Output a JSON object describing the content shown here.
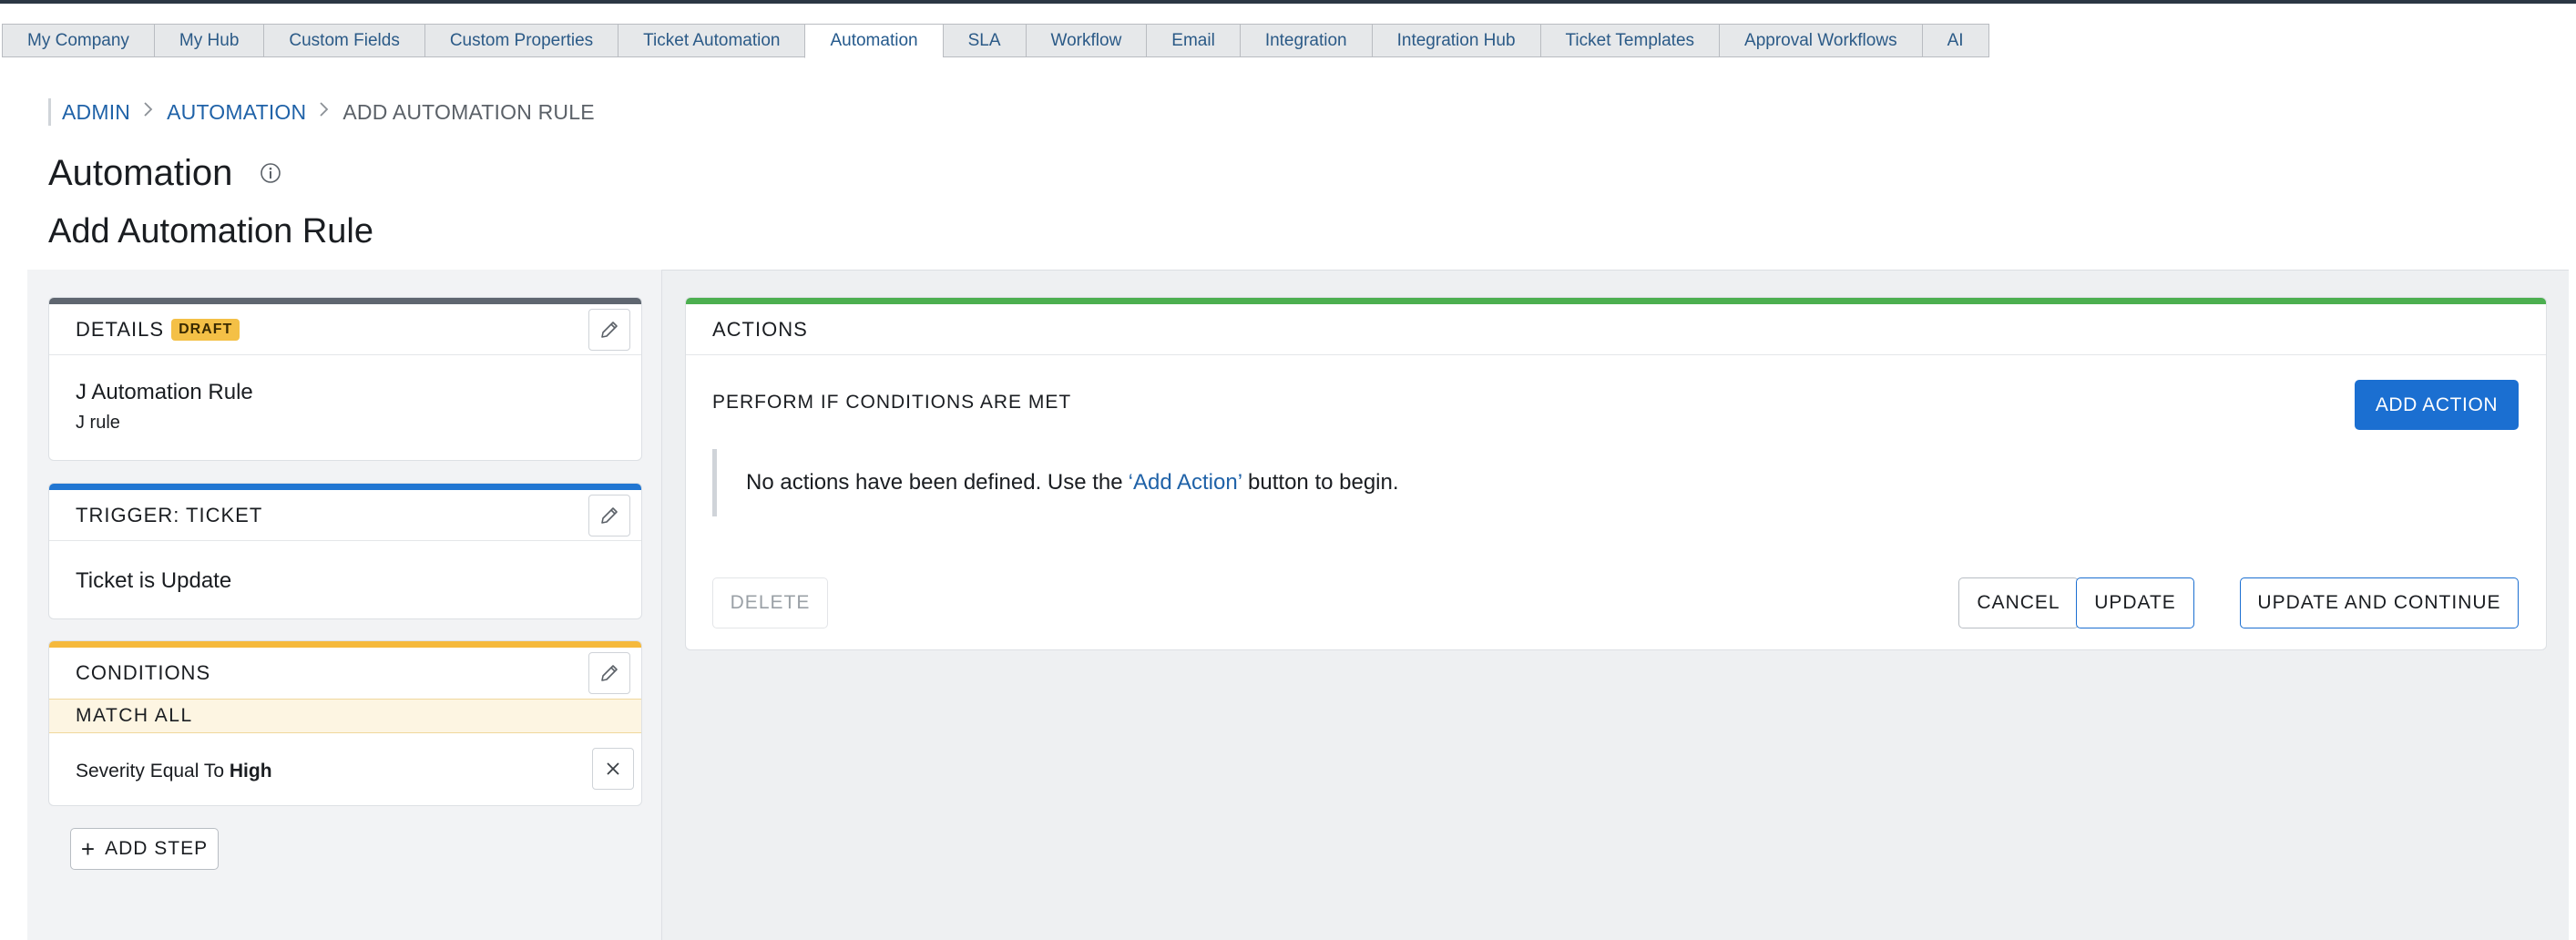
{
  "tabs": [
    {
      "label": "My Company",
      "active": false
    },
    {
      "label": "My Hub",
      "active": false
    },
    {
      "label": "Custom Fields",
      "active": false
    },
    {
      "label": "Custom Properties",
      "active": false
    },
    {
      "label": "Ticket Automation",
      "active": false
    },
    {
      "label": "Automation",
      "active": true
    },
    {
      "label": "SLA",
      "active": false
    },
    {
      "label": "Workflow",
      "active": false
    },
    {
      "label": "Email",
      "active": false
    },
    {
      "label": "Integration",
      "active": false
    },
    {
      "label": "Integration Hub",
      "active": false
    },
    {
      "label": "Ticket Templates",
      "active": false
    },
    {
      "label": "Approval Workflows",
      "active": false
    },
    {
      "label": "AI",
      "active": false
    }
  ],
  "breadcrumb": {
    "admin": "ADMIN",
    "automation": "AUTOMATION",
    "current": "ADD AUTOMATION RULE"
  },
  "page": {
    "title": "Automation",
    "subtitle": "Add Automation Rule"
  },
  "details": {
    "header": "DETAILS",
    "badge": "DRAFT",
    "name": "J Automation Rule",
    "description": "J rule"
  },
  "trigger": {
    "header": "TRIGGER: TICKET",
    "text": "Ticket is Update"
  },
  "conditions": {
    "header": "CONDITIONS",
    "match": "MATCH ALL",
    "rows": [
      {
        "prefix": "Severity Equal To",
        "value": "High"
      }
    ]
  },
  "add_step": {
    "plus": "+",
    "label": "ADD STEP"
  },
  "actions": {
    "header": "ACTIONS",
    "perform_label": "PERFORM IF CONDITIONS ARE MET",
    "add_action": "ADD ACTION",
    "empty_before": "No actions have been defined. Use the",
    "empty_link": "‘Add Action’",
    "empty_after": "button to begin.",
    "delete": "DELETE",
    "cancel": "CANCEL",
    "update": "UPDATE",
    "update_continue": "UPDATE AND CONTINUE"
  },
  "colors": {
    "details_accent": "#5f6670",
    "trigger_accent": "#2176d2",
    "conditions_accent": "#f5b93c",
    "actions_accent": "#4caf50",
    "primary": "#1b6fd1"
  },
  "icons": {
    "info": "info-icon",
    "edit": "pencil-icon",
    "remove": "close-icon",
    "breadcrumb_sep": "chevron-right-icon"
  }
}
